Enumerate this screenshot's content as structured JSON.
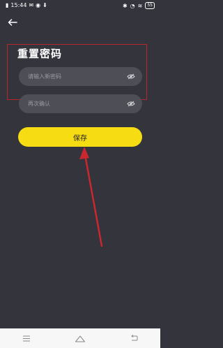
{
  "status_bar": {
    "time": "15:44",
    "battery": "55"
  },
  "page": {
    "title": "重置密码"
  },
  "form": {
    "new_password_placeholder": "请输入新密码",
    "confirm_placeholder": "再次确认"
  },
  "actions": {
    "save_label": "保存"
  },
  "colors": {
    "background": "#33343c",
    "accent": "#f5dc13",
    "input_bg": "#4d4e56",
    "annotation": "#b8262c"
  },
  "icons": [
    "back-arrow-icon",
    "eye-off-icon",
    "menu-icon",
    "home-icon",
    "return-icon"
  ]
}
